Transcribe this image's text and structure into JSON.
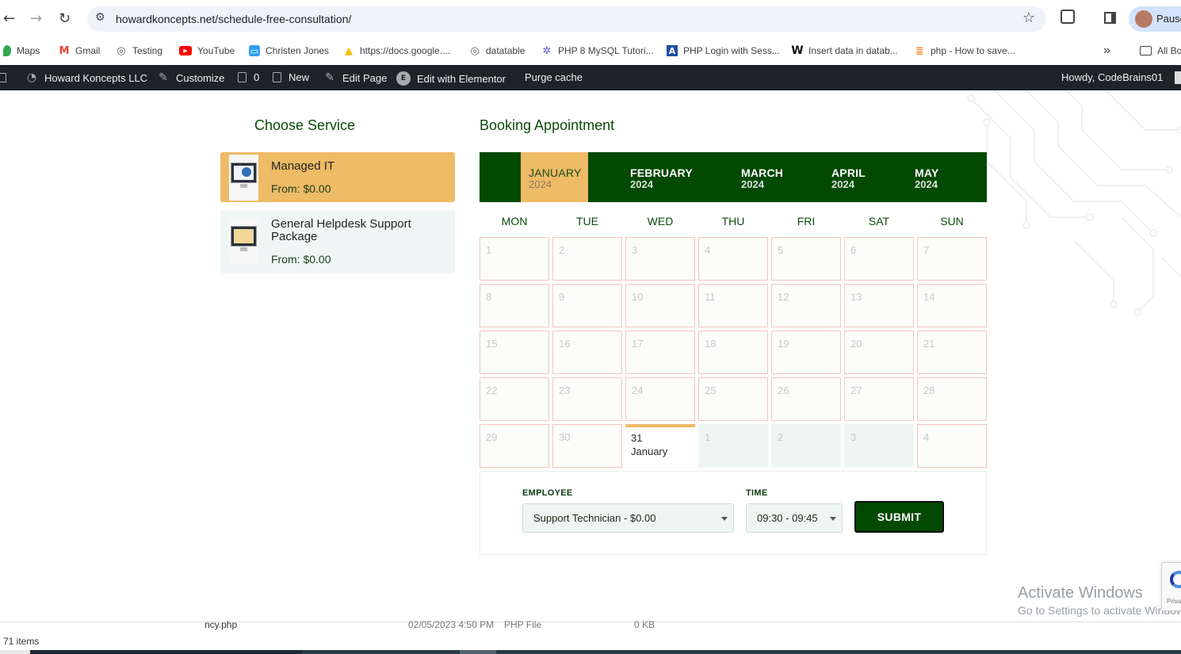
{
  "browser": {
    "url": "howardkoncepts.net/schedule-free-consultation/",
    "profile_label": "Pause",
    "bookmarks": [
      {
        "label": "Maps",
        "icon": "maps-pin-icon",
        "color": "#34a853"
      },
      {
        "label": "Gmail",
        "icon": "gmail-icon",
        "color": "#ea4335"
      },
      {
        "label": "Testing",
        "icon": "globe-icon",
        "color": "#5f6368"
      },
      {
        "label": "YouTube",
        "icon": "youtube-icon",
        "color": "#ff0000"
      },
      {
        "label": "Christen Jones",
        "icon": "chat-icon",
        "color": "#2da0f0"
      },
      {
        "label": "https://docs.google....",
        "icon": "drive-icon",
        "color": "#fbbc04"
      },
      {
        "label": "datatable",
        "icon": "globe-icon",
        "color": "#5f6368"
      },
      {
        "label": "PHP 8 MySQL Tutori...",
        "icon": "gear-icon",
        "color": "#5a5ae0"
      },
      {
        "label": "PHP Login with Sess...",
        "icon": "a-logo-icon",
        "color": "#1a4fa0"
      },
      {
        "label": "Insert data in datab...",
        "icon": "w-logo-icon",
        "color": "#111111"
      },
      {
        "label": "php - How to save...",
        "icon": "stack-icon",
        "color": "#f48024"
      }
    ],
    "bookmarks_overflow": "»",
    "all_bookmarks": "All Bo"
  },
  "wp_admin": {
    "site_name": "Howard Koncepts LLC",
    "customize": "Customize",
    "comments_count": "0",
    "new": "New",
    "edit_page": "Edit Page",
    "edit_elementor": "Edit with Elementor",
    "purge_cache": "Purge cache",
    "howdy": "Howdy, CodeBrains01"
  },
  "services": {
    "heading": "Choose Service",
    "items": [
      {
        "name": "Managed IT",
        "price": "From: $0.00",
        "selected": true
      },
      {
        "name": "General Helpdesk Support Package",
        "price": "From: $0.00",
        "selected": false
      }
    ]
  },
  "booking": {
    "heading": "Booking Appointment",
    "months": [
      {
        "name": "JANUARY",
        "year": "2024",
        "active": true
      },
      {
        "name": "FEBRUARY",
        "year": "2024",
        "active": false
      },
      {
        "name": "MARCH",
        "year": "2024",
        "active": false
      },
      {
        "name": "APRIL",
        "year": "2024",
        "active": false
      },
      {
        "name": "MAY",
        "year": "2024",
        "active": false
      }
    ],
    "weekdays": [
      "MON",
      "TUE",
      "WED",
      "THU",
      "FRI",
      "SAT",
      "SUN"
    ],
    "weeks": [
      [
        "1",
        "2",
        "3",
        "4",
        "5",
        "6",
        "7"
      ],
      [
        "8",
        "9",
        "10",
        "11",
        "12",
        "13",
        "14"
      ],
      [
        "15",
        "16",
        "17",
        "18",
        "19",
        "20",
        "21"
      ],
      [
        "22",
        "23",
        "24",
        "25",
        "26",
        "27",
        "28"
      ],
      [
        "29",
        "30",
        "31",
        "1",
        "2",
        "3",
        "4"
      ]
    ],
    "selected_day": {
      "num": "31",
      "month": "January"
    },
    "employee_label": "EMPLOYEE",
    "employee_value": "Support Technician - $0.00",
    "time_label": "TIME",
    "time_value": "09:30 - 09:45",
    "submit": "SUBMIT"
  },
  "windows": {
    "activate_title": "Activate Windows",
    "activate_sub": "Go to Settings to activate Windows.",
    "recaptcha": "Priva"
  },
  "explorer": {
    "file_name": "ncy.php",
    "file_date": "02/05/2023 4:50 PM",
    "file_type": "PHP File",
    "file_size": "0 KB",
    "items": "71 items"
  },
  "colors": {
    "accent_green": "#024902",
    "accent_gold": "#eebb66",
    "wp_bar": "#1d2327"
  }
}
